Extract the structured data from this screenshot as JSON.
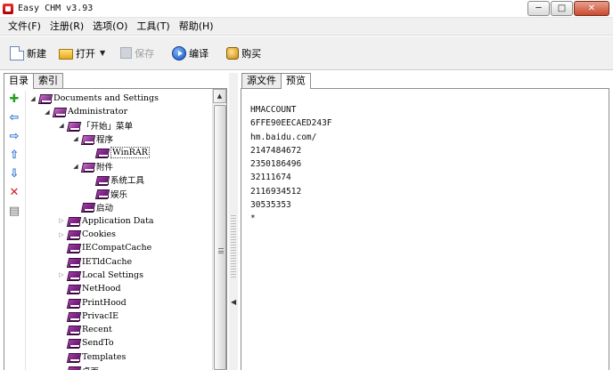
{
  "window": {
    "title": "Easy CHM v3.93",
    "minimize": "─",
    "maximize": "□",
    "close": "✕"
  },
  "menu": [
    "文件(F)",
    "注册(R)",
    "选项(O)",
    "工具(T)",
    "帮助(H)"
  ],
  "toolbar": {
    "new_label": "新建",
    "open_label": "打开",
    "save_label": "保存",
    "compile_label": "编译",
    "buy_label": "购买"
  },
  "left_tabs": [
    "目录",
    "索引"
  ],
  "side_buttons": [
    {
      "icon": "add-icon",
      "glyph": "✚"
    },
    {
      "icon": "arrow-left-icon",
      "glyph": "⇦"
    },
    {
      "icon": "arrow-right-icon",
      "glyph": "⇨"
    },
    {
      "icon": "arrow-up-icon",
      "glyph": "⇧"
    },
    {
      "icon": "arrow-down-icon",
      "glyph": "⇩"
    },
    {
      "icon": "delete-icon",
      "glyph": "✕"
    },
    {
      "icon": "properties-icon",
      "glyph": "▤"
    }
  ],
  "tree": [
    {
      "label": "Documents and Settings",
      "level": 0,
      "expander": "open",
      "selected": false
    },
    {
      "label": "Administrator",
      "level": 1,
      "expander": "open",
      "selected": false
    },
    {
      "label": "「开始」菜单",
      "level": 2,
      "expander": "open",
      "selected": false
    },
    {
      "label": "程序",
      "level": 3,
      "expander": "open",
      "selected": false
    },
    {
      "label": "WinRAR",
      "level": 4,
      "expander": "none",
      "selected": true
    },
    {
      "label": "附件",
      "level": 3,
      "expander": "open",
      "selected": false
    },
    {
      "label": "系统工具",
      "level": 4,
      "expander": "none",
      "selected": false
    },
    {
      "label": "娱乐",
      "level": 4,
      "expander": "none",
      "selected": false
    },
    {
      "label": "启动",
      "level": 3,
      "expander": "none",
      "selected": false
    },
    {
      "label": "Application Data",
      "level": 2,
      "expander": "collapsed",
      "selected": false
    },
    {
      "label": "Cookies",
      "level": 2,
      "expander": "collapsed",
      "selected": false
    },
    {
      "label": "IECompatCache",
      "level": 2,
      "expander": "none",
      "selected": false
    },
    {
      "label": "IETldCache",
      "level": 2,
      "expander": "none",
      "selected": false
    },
    {
      "label": "Local Settings",
      "level": 2,
      "expander": "collapsed",
      "selected": false
    },
    {
      "label": "NetHood",
      "level": 2,
      "expander": "none",
      "selected": false
    },
    {
      "label": "PrintHood",
      "level": 2,
      "expander": "none",
      "selected": false
    },
    {
      "label": "PrivacIE",
      "level": 2,
      "expander": "none",
      "selected": false
    },
    {
      "label": "Recent",
      "level": 2,
      "expander": "none",
      "selected": false
    },
    {
      "label": "SendTo",
      "level": 2,
      "expander": "none",
      "selected": false
    },
    {
      "label": "Templates",
      "level": 2,
      "expander": "none",
      "selected": false
    },
    {
      "label": "桌面",
      "level": 2,
      "expander": "none",
      "selected": false
    }
  ],
  "right_tabs": [
    "源文件",
    "预览"
  ],
  "preview_lines": [
    "HMACCOUNT",
    "6FFE90EECAED243F",
    "hm.baidu.com/",
    "2147484672",
    "2350186496",
    "32111674",
    "2116934512",
    "30535353",
    "*"
  ]
}
